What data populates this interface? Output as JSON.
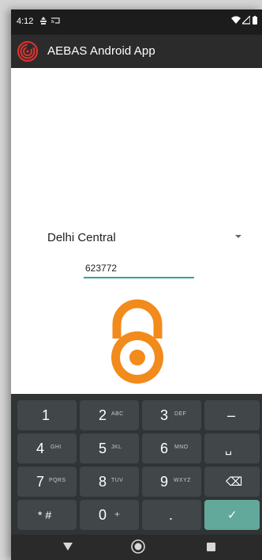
{
  "status_bar": {
    "time": "4:12",
    "icons": [
      "notification-icon",
      "cast-icon",
      "wifi-icon",
      "signal-icon",
      "battery-icon"
    ]
  },
  "app_bar": {
    "title": "AEBAS Android App",
    "logo_icon": "fingerprint-icon",
    "logo_color": "#e5322d"
  },
  "location_spinner": {
    "selected": "Delhi Central"
  },
  "code_field": {
    "value": "623772",
    "underline_color": "#2aa79b"
  },
  "lock_icon": {
    "name": "lock-icon",
    "color": "#f28a1c"
  },
  "keyboard": {
    "rows": [
      [
        {
          "main": "1",
          "sub": ""
        },
        {
          "main": "2",
          "sub": "ABC"
        },
        {
          "main": "3",
          "sub": "DEF"
        },
        {
          "main": "–",
          "sub": ""
        }
      ],
      [
        {
          "main": "4",
          "sub": "GHI"
        },
        {
          "main": "5",
          "sub": "JKL"
        },
        {
          "main": "6",
          "sub": "MNO"
        },
        {
          "main": "␣",
          "sub": ""
        }
      ],
      [
        {
          "main": "7",
          "sub": "PQRS"
        },
        {
          "main": "8",
          "sub": "TUV"
        },
        {
          "main": "9",
          "sub": "WXYZ"
        },
        {
          "main": "⌫",
          "sub": ""
        }
      ],
      [
        {
          "main": "* #",
          "sub": ""
        },
        {
          "main": "0",
          "sub": "+"
        },
        {
          "main": ".",
          "sub": ""
        },
        {
          "main": "✓",
          "sub": ""
        }
      ]
    ],
    "done_color": "#62a89b"
  },
  "nav_bar": {
    "back": "back-icon",
    "home": "home-icon",
    "recents": "recents-icon"
  }
}
